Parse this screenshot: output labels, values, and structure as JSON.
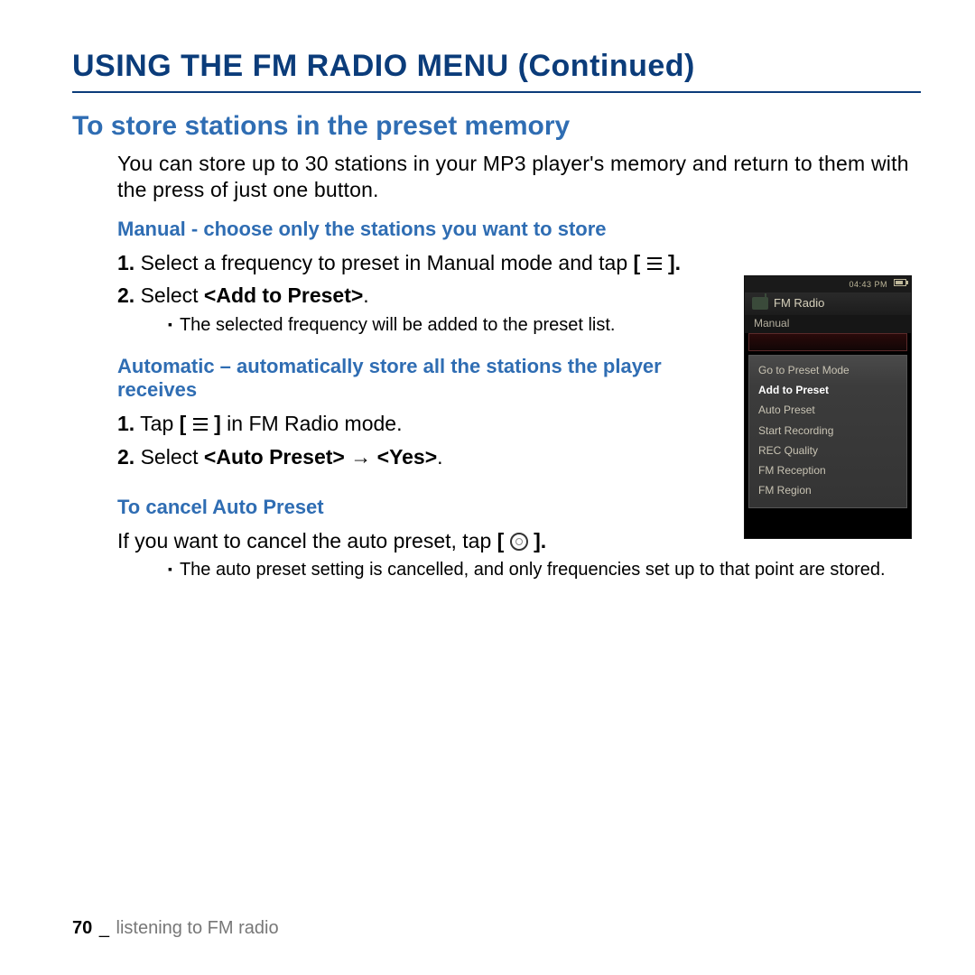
{
  "pageTitle": "USING THE FM RADIO MENU (Continued)",
  "sectionHeading": "To store stations in the preset memory",
  "intro": "You can store up to 30 stations in your MP3 player's memory and return to them with the press of just one button.",
  "manual": {
    "heading": "Manual - choose only the stations you want to store",
    "step1_prefix": "1.",
    "step1_a": "Select a frequency to preset in Manual mode and tap ",
    "step1_b": "[",
    "step1_c": "].",
    "step2_prefix": "2.",
    "step2_a": "Select ",
    "step2_bold": "<Add to Preset>",
    "step2_c": ".",
    "bullet": "The selected frequency will be added to the preset list."
  },
  "automatic": {
    "heading": "Automatic – automatically store all the stations the player receives",
    "step1_prefix": "1.",
    "step1_a": "Tap ",
    "step1_b": "[",
    "step1_c": "]",
    "step1_d": " in FM Radio mode.",
    "step2_prefix": "2.",
    "step2_a": "Select ",
    "step2_bold1": "<Auto Preset>",
    "step2_arrow": " → ",
    "step2_bold2": "<Yes>",
    "step2_c": "."
  },
  "cancel": {
    "heading": "To cancel Auto Preset",
    "line_a": "If you want to cancel the auto preset, tap ",
    "line_b": "[",
    "line_c": "].",
    "bullet": "The auto preset setting is cancelled, and only frequencies set up to that point are stored."
  },
  "device": {
    "time": "04:43 PM",
    "title": "FM Radio",
    "mode": "Manual",
    "menu": [
      "Go to Preset Mode",
      "Add to Preset",
      "Auto Preset",
      "Start Recording",
      "REC Quality",
      "FM Reception",
      "FM Region"
    ],
    "selectedIndex": 1
  },
  "footer": {
    "pageNum": "70",
    "sep": "_",
    "chapter": "listening to FM radio"
  }
}
